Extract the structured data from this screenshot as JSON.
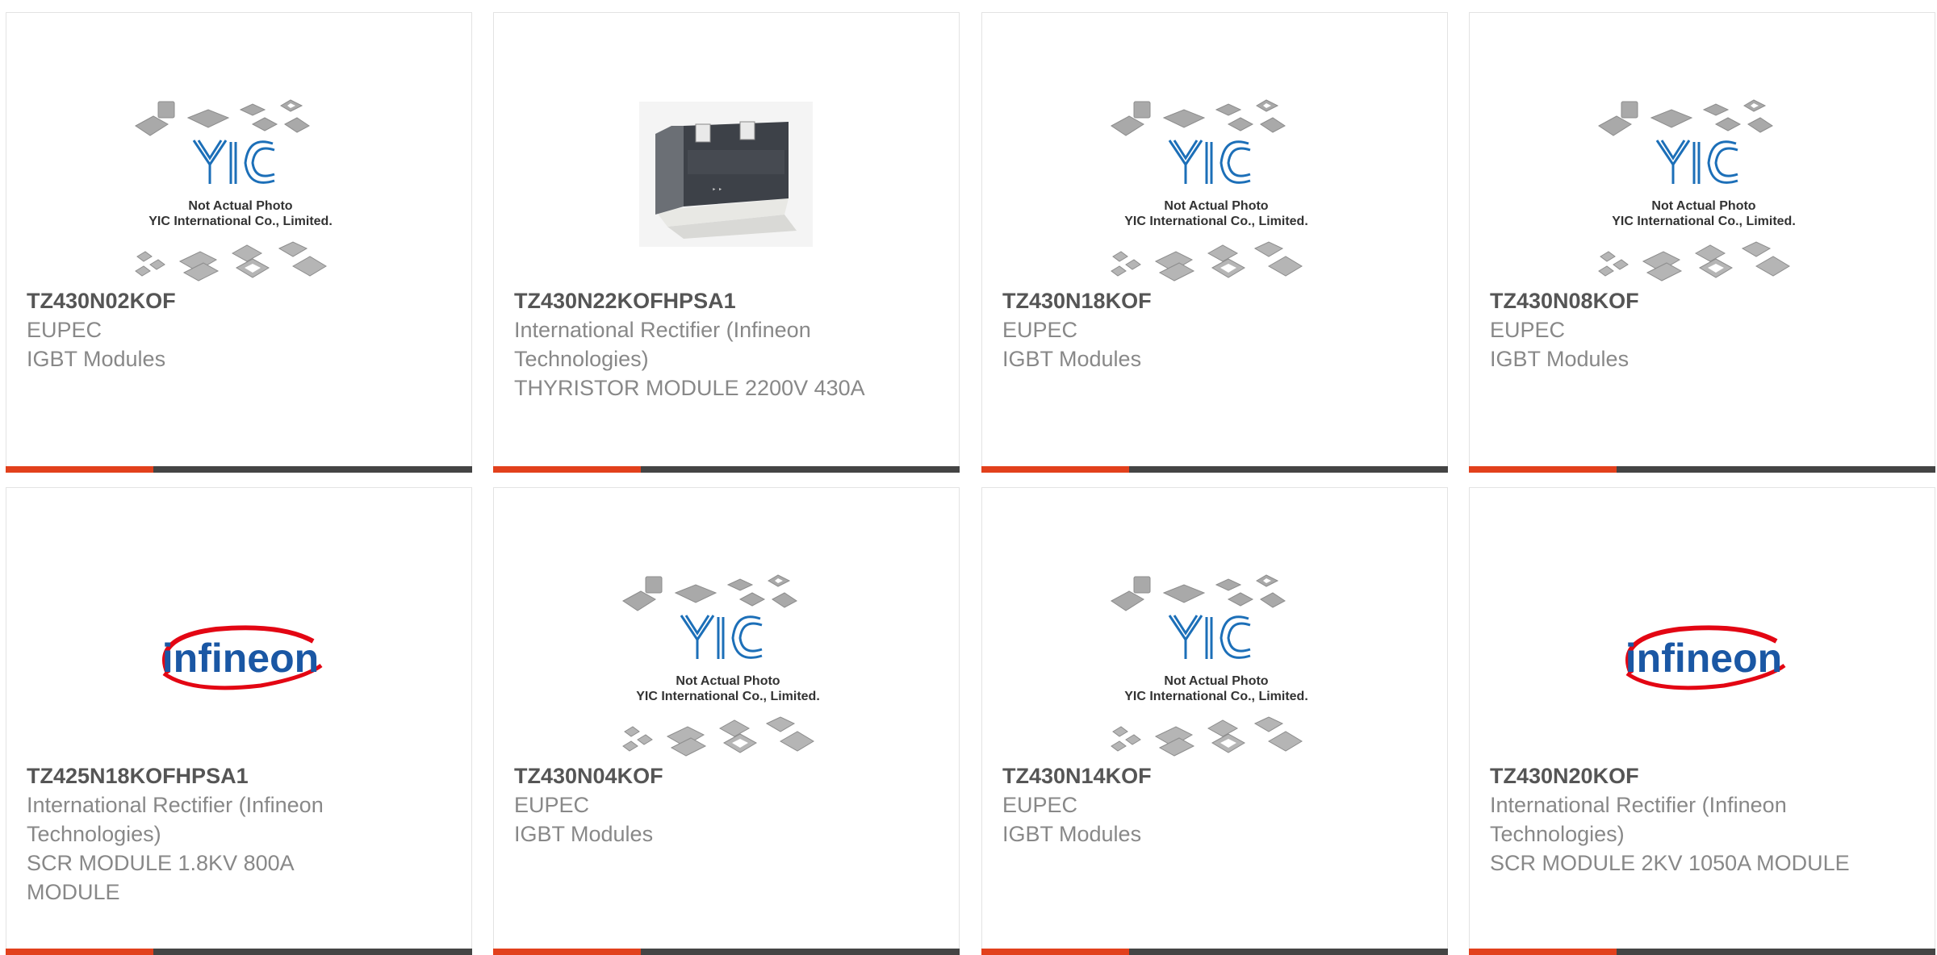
{
  "placeholder": {
    "caption_line1": "Not Actual Photo",
    "caption_line2": "YIC International Co., Limited.",
    "logo_text": "YIC"
  },
  "brand_logo": {
    "text": "infineon",
    "text_color": "#1a57a4",
    "swoosh_color": "#e30613"
  },
  "colors": {
    "accent": "#e2401c",
    "bar": "#444444",
    "part_number": "#555555",
    "body_text": "#888888",
    "border": "#e3e3e3"
  },
  "products": [
    {
      "part_number": "TZ430N02KOF",
      "manufacturer": "EUPEC",
      "description": "IGBT Modules",
      "image": "placeholder-image"
    },
    {
      "part_number": "TZ430N22KOFHPSA1",
      "manufacturer": "International Rectifier (Infineon Technologies)",
      "description": "THYRISTOR MODULE 2200V 430A",
      "image": "thyristor-module-photo"
    },
    {
      "part_number": "TZ430N18KOF",
      "manufacturer": "EUPEC",
      "description": "IGBT Modules",
      "image": "placeholder-image"
    },
    {
      "part_number": "TZ430N08KOF",
      "manufacturer": "EUPEC",
      "description": "IGBT Modules",
      "image": "placeholder-image"
    },
    {
      "part_number": "TZ425N18KOFHPSA1",
      "manufacturer": "International Rectifier (Infineon Technologies)",
      "description": "SCR MODULE 1.8KV 800A MODULE",
      "image": "infineon-logo"
    },
    {
      "part_number": "TZ430N04KOF",
      "manufacturer": "EUPEC",
      "description": "IGBT Modules",
      "image": "placeholder-image"
    },
    {
      "part_number": "TZ430N14KOF",
      "manufacturer": "EUPEC",
      "description": "IGBT Modules",
      "image": "placeholder-image"
    },
    {
      "part_number": "TZ430N20KOF",
      "manufacturer": "International Rectifier (Infineon Technologies)",
      "description": "SCR MODULE 2KV 1050A MODULE",
      "image": "infineon-logo"
    }
  ]
}
